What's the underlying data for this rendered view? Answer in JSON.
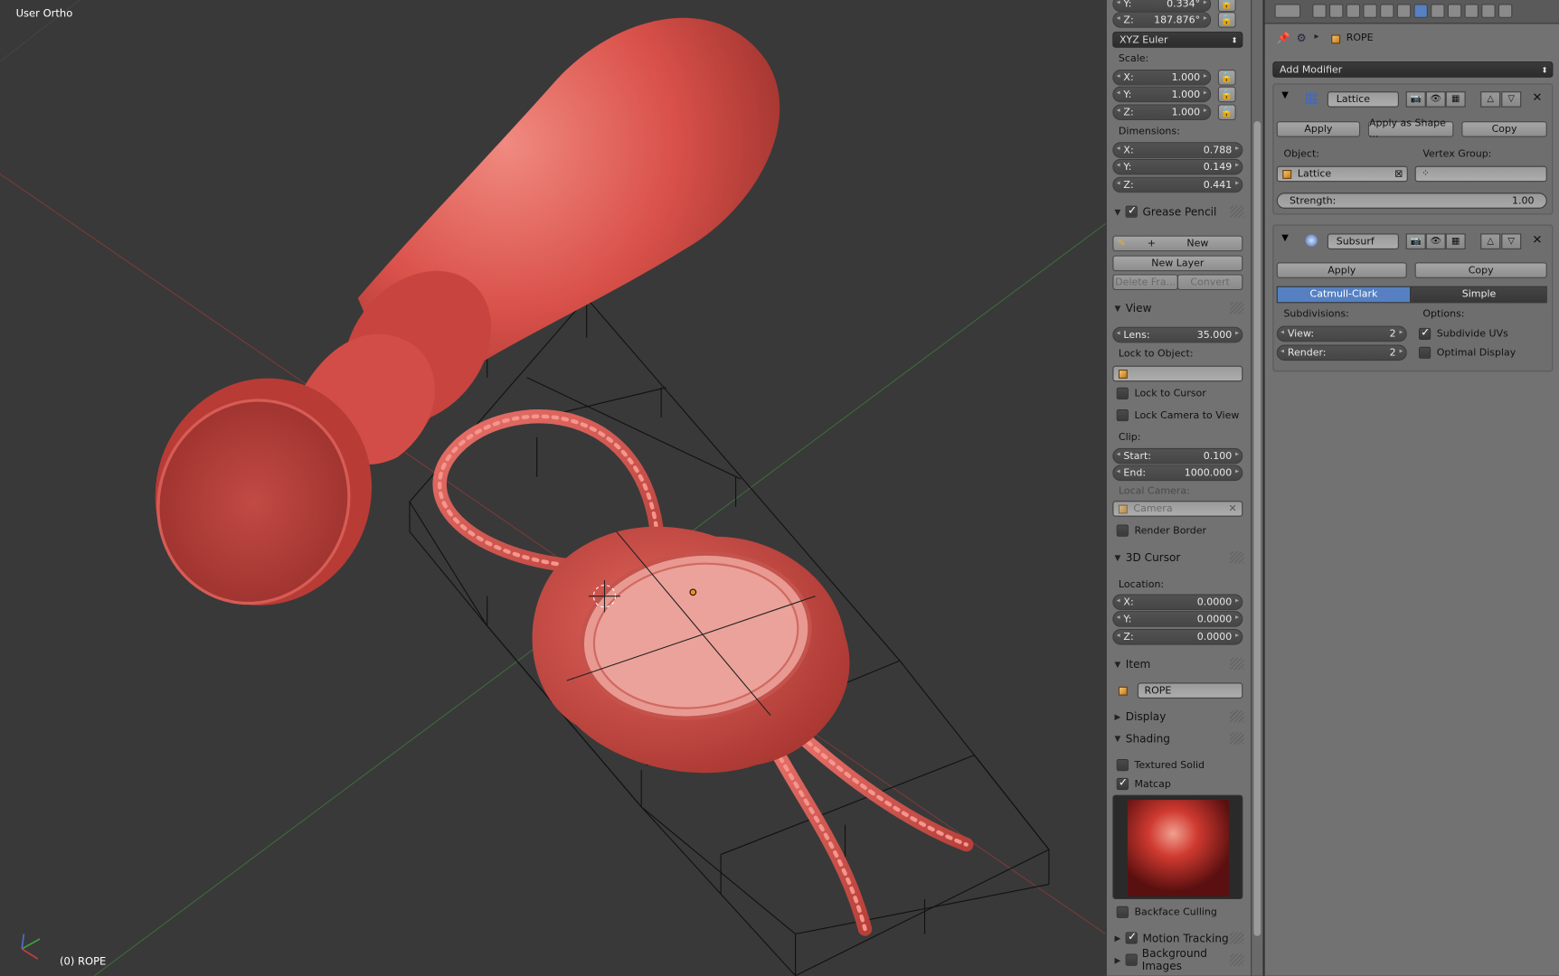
{
  "viewport": {
    "view_label": "User Ortho",
    "object_label": "(0) ROPE"
  },
  "transform": {
    "rotation_y": "0.334°",
    "rotation_z": "187.876°",
    "rotation_mode": "XYZ Euler",
    "scale_label": "Scale:",
    "scale": [
      {
        "axis": "X:",
        "value": "1.000"
      },
      {
        "axis": "Y:",
        "value": "1.000"
      },
      {
        "axis": "Z:",
        "value": "1.000"
      }
    ],
    "dimensions_label": "Dimensions:",
    "dimensions": [
      {
        "axis": "X:",
        "value": "0.788"
      },
      {
        "axis": "Y:",
        "value": "0.149"
      },
      {
        "axis": "Z:",
        "value": "0.441"
      }
    ]
  },
  "grease_pencil": {
    "title": "Grease Pencil",
    "new_label": "New",
    "new_layer_label": "New Layer",
    "delete_frame_label": "Delete Fra...",
    "convert_label": "Convert"
  },
  "view_panel": {
    "title": "View",
    "lens_label": "Lens:",
    "lens_value": "35.000",
    "lock_to_object_label": "Lock to Object:",
    "lock_to_cursor_label": "Lock to Cursor",
    "lock_camera_label": "Lock Camera to View",
    "clip_label": "Clip:",
    "clip_start_label": "Start:",
    "clip_start_value": "0.100",
    "clip_end_label": "End:",
    "clip_end_value": "1000.000",
    "local_camera_label": "Local Camera:",
    "camera_value": "Camera",
    "render_border_label": "Render Border"
  },
  "cursor_panel": {
    "title": "3D Cursor",
    "location_label": "Location:",
    "location": [
      {
        "axis": "X:",
        "value": "0.0000"
      },
      {
        "axis": "Y:",
        "value": "0.0000"
      },
      {
        "axis": "Z:",
        "value": "0.0000"
      }
    ]
  },
  "item_panel": {
    "title": "Item",
    "name": "ROPE"
  },
  "display_panel": {
    "title": "Display"
  },
  "shading_panel": {
    "title": "Shading",
    "textured_solid_label": "Textured Solid",
    "matcap_label": "Matcap",
    "backface_culling_label": "Backface Culling"
  },
  "motion_tracking": {
    "title": "Motion Tracking"
  },
  "background_images": {
    "title": "Background Images"
  },
  "properties": {
    "object_name": "ROPE",
    "add_modifier_label": "Add Modifier",
    "lattice": {
      "name": "Lattice",
      "apply_label": "Apply",
      "apply_shape_label": "Apply as Shape ...",
      "copy_label": "Copy",
      "object_label": "Object:",
      "object_value": "Lattice",
      "vertex_group_label": "Vertex Group:",
      "strength_label": "Strength:",
      "strength_value": "1.00"
    },
    "subsurf": {
      "name": "Subsurf",
      "apply_label": "Apply",
      "copy_label": "Copy",
      "catmull_label": "Catmull-Clark",
      "simple_label": "Simple",
      "subdivisions_label": "Subdivisions:",
      "options_label": "Options:",
      "view_label": "View:",
      "view_value": "2",
      "render_label": "Render:",
      "render_value": "2",
      "subdivide_uvs_label": "Subdivide UVs",
      "optimal_display_label": "Optimal Display"
    }
  },
  "colors": {
    "accent": "#5680c2",
    "wax": "#d9514a",
    "panel": "#727272"
  }
}
